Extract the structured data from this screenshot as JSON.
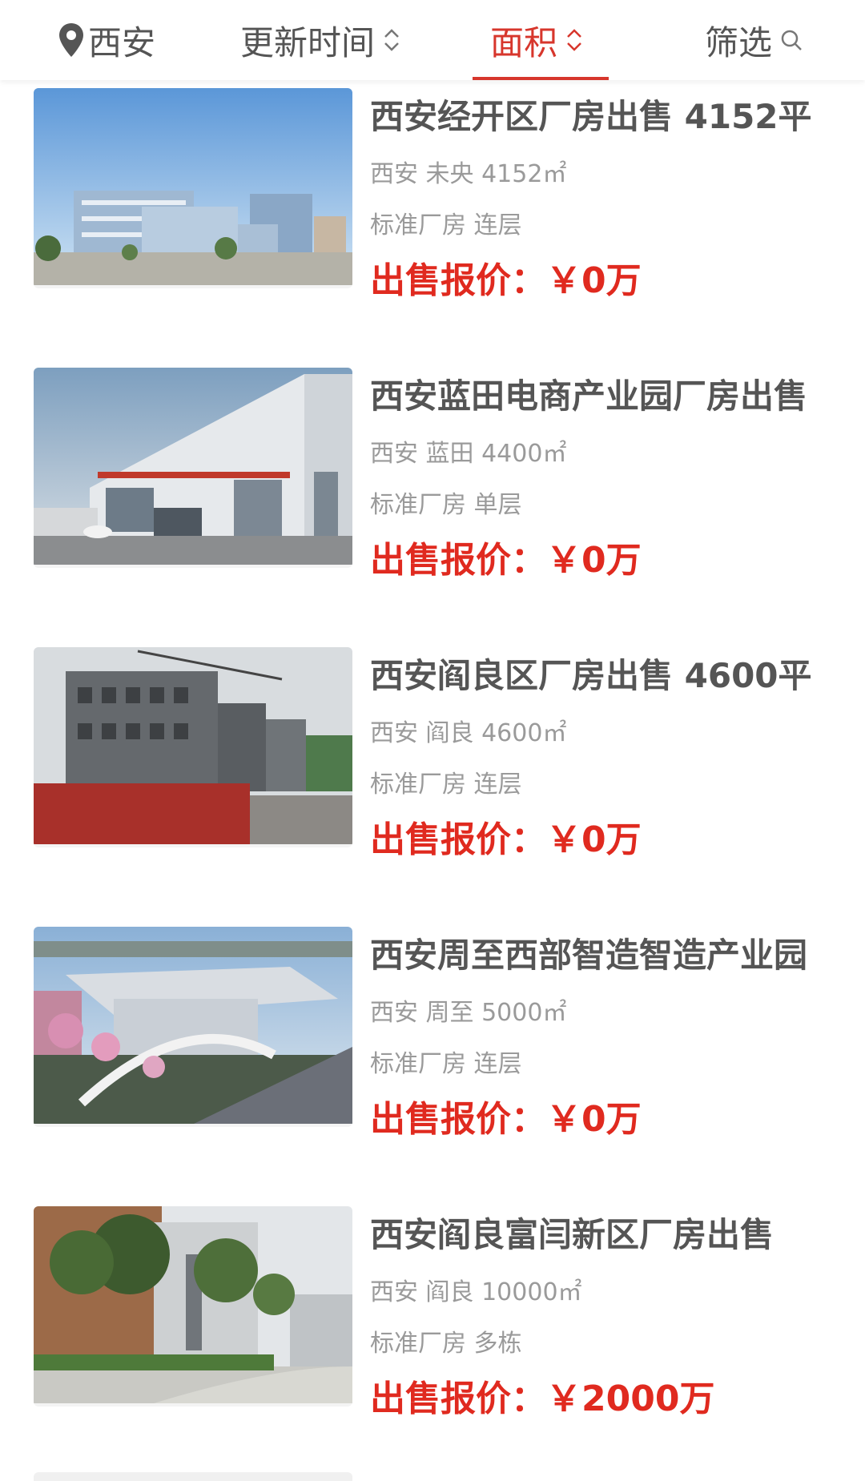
{
  "header": {
    "city": "西安",
    "sort_time_label": "更新时间",
    "sort_area_label": "面积",
    "filter_label": "筛选",
    "active_tab": "面积",
    "accent_color": "#d7362c"
  },
  "listings": [
    {
      "title": "西安经开区厂房出售 4152平",
      "city": "西安",
      "district": "未央",
      "area": "4152㎡",
      "tags": "标准厂房 连层",
      "price_label": "出售报价：",
      "price_value": "￥0万"
    },
    {
      "title": "西安蓝田电商产业园厂房出售",
      "city": "西安",
      "district": "蓝田",
      "area": "4400㎡",
      "tags": "标准厂房 单层",
      "price_label": "出售报价：",
      "price_value": "￥0万"
    },
    {
      "title": "西安阎良区厂房出售 4600平",
      "city": "西安",
      "district": "阎良",
      "area": "4600㎡",
      "tags": "标准厂房 连层",
      "price_label": "出售报价：",
      "price_value": "￥0万"
    },
    {
      "title": "西安周至西部智造智造产业园",
      "city": "西安",
      "district": "周至",
      "area": "5000㎡",
      "tags": "标准厂房 连层",
      "price_label": "出售报价：",
      "price_value": "￥0万"
    },
    {
      "title": "西安阎良富闫新区厂房出售",
      "city": "西安",
      "district": "阎良",
      "area": "10000㎡",
      "tags": "标准厂房 多栋",
      "price_label": "出售报价：",
      "price_value": "￥2000万"
    }
  ],
  "icons": {
    "location": "location-pin-icon",
    "sort": "sort-chevrons-icon",
    "search": "search-icon"
  },
  "colors": {
    "price": "#e02a1f",
    "title": "#555555",
    "meta": "#9a9a9a"
  }
}
